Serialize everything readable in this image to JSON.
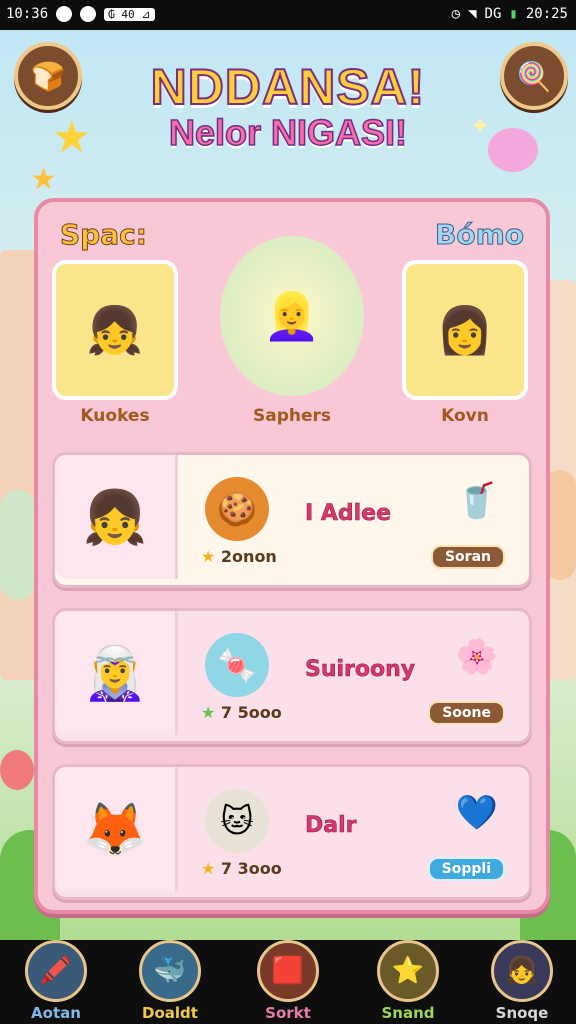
{
  "status_bar": {
    "time_left": "10:36",
    "pill": "₲ 40 ⊿",
    "net": "DG",
    "time_right": "20:25"
  },
  "header": {
    "left_icon": "toast-icon",
    "right_icon": "popsicle-icon",
    "title_main": "NDDANSA!",
    "title_sub": "Nelor NIGASI!"
  },
  "team": {
    "left_label": "Spac:",
    "right_label": "Bómo",
    "characters": [
      {
        "name": "Kuokes"
      },
      {
        "name": "Saphers"
      },
      {
        "name": "Kovn"
      }
    ]
  },
  "rows": [
    {
      "item_name": "I Adlee",
      "price": "2onon",
      "button": "Soran",
      "item_icon": "cookie-icon",
      "reward_icon": "drink-icon"
    },
    {
      "item_name": "Suiroony",
      "price": "7 5ooo",
      "button": "Soone",
      "item_icon": "candy-icon",
      "reward_icon": "pink-blob-icon"
    },
    {
      "item_name": "Dalr",
      "price": "7 3ooo",
      "button": "Soppli",
      "item_icon": "cat-girl-icon",
      "reward_icon": "blue-hair-girl-icon"
    }
  ],
  "navbar": [
    {
      "label": "Aotan",
      "icon": "crayon-icon",
      "color": "#7fb9e8"
    },
    {
      "label": "Doaldt",
      "icon": "blob-pet-icon",
      "color": "#f2c84b"
    },
    {
      "label": "Sorkt",
      "icon": "gem-icon",
      "color": "#e77aa8"
    },
    {
      "label": "Snand",
      "icon": "star-icon",
      "color": "#9ad65a"
    },
    {
      "label": "Snoqe",
      "icon": "girl-avatar-icon",
      "color": "#d8d8d8"
    }
  ]
}
